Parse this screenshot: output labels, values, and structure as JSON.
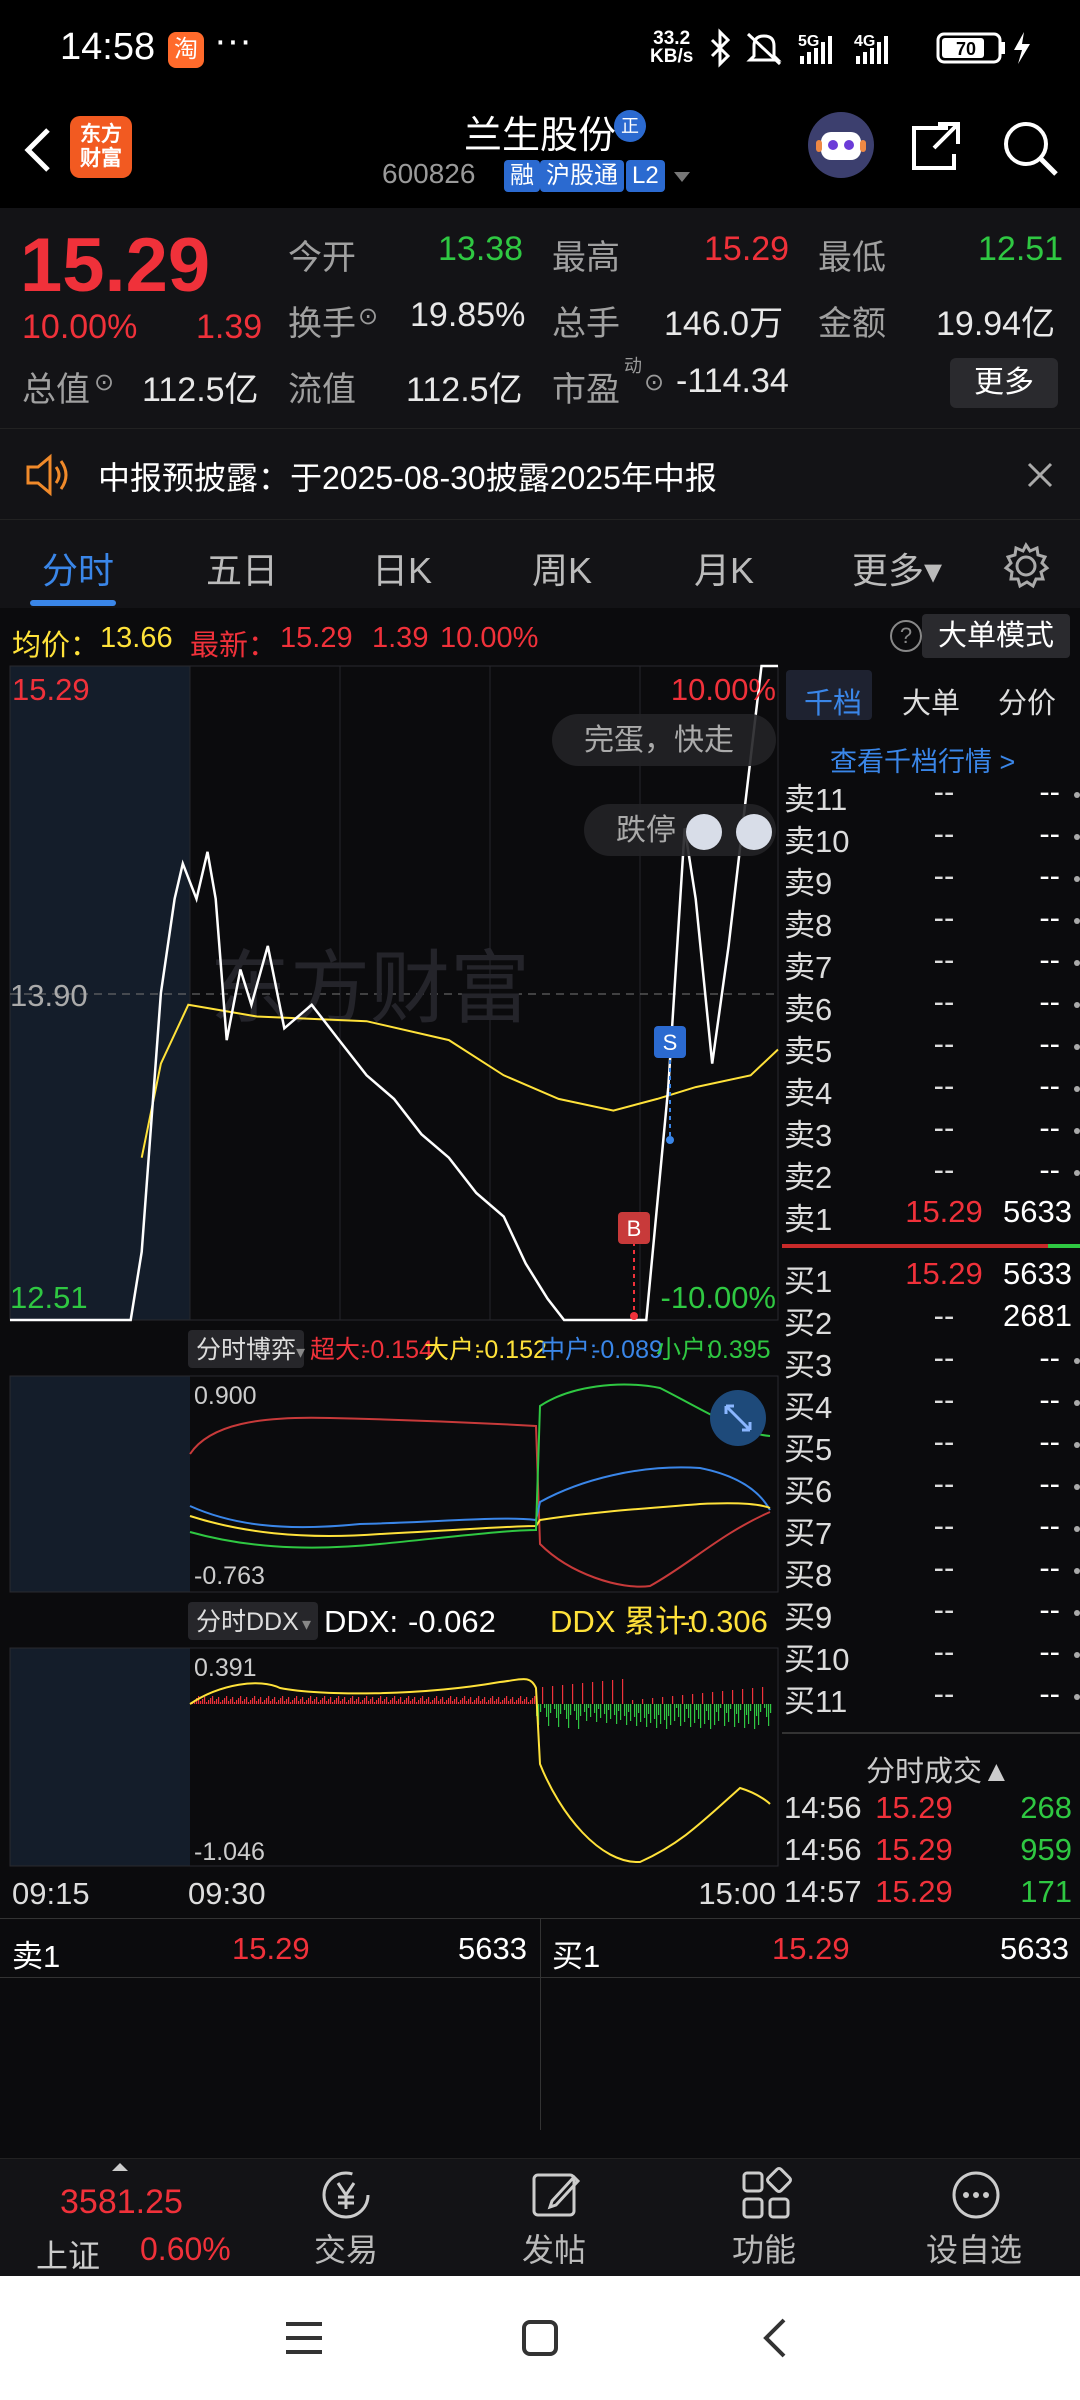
{
  "status_bar": {
    "time": "14:58",
    "dots": "···",
    "net_speed_value": "33.2",
    "net_speed_unit": "KB/s",
    "signals": "5G 4G",
    "battery": "70"
  },
  "header": {
    "title": "兰生股份",
    "badge_zheng": "正",
    "code": "600826",
    "tag_rong": "融",
    "tag_hgt": "沪股通",
    "tag_l2": "L2",
    "logo_line1": "东方",
    "logo_line2": "财富"
  },
  "quote": {
    "price": "15.29",
    "change_pct": "10.00%",
    "change": "1.39",
    "open_label": "今开",
    "open": "13.38",
    "high_label": "最高",
    "high": "15.29",
    "low_label": "最低",
    "low": "12.51",
    "turnover_label": "换手",
    "turnover": "19.85%",
    "volume_label": "总手",
    "volume": "146.0万",
    "amount_label": "金额",
    "amount": "19.94亿",
    "mktcap_label": "总值",
    "mktcap": "112.5亿",
    "float_label": "流值",
    "float_cap": "112.5亿",
    "pe_label": "市盈",
    "pe_sup": "动",
    "pe": "-114.34",
    "more_label": "更多"
  },
  "notice": {
    "text": "中报预披露：于2025-08-30披露2025年中报"
  },
  "tabs": [
    {
      "label": "分时"
    },
    {
      "label": "五日"
    },
    {
      "label": "日K"
    },
    {
      "label": "周K"
    },
    {
      "label": "月K"
    },
    {
      "label": "更多▾"
    }
  ],
  "infoline": {
    "avg_label": "均价：",
    "avg": "13.66",
    "last_label": "最新：",
    "last": "15.29",
    "chg": "1.39",
    "pct": "10.00%",
    "help": "?",
    "big_order_mode": "大单模式"
  },
  "chart": {
    "price_top": "15.29",
    "price_mid": "13.90",
    "price_bot": "12.51",
    "pct_top": "10.00%",
    "pct_bot": "-10.00%",
    "bubble1": "完蛋，快走",
    "bubble2": "跌停",
    "marker_s": "S",
    "marker_b": "B",
    "watermark": "东方财富",
    "bottom_tag": "分时博弈",
    "super_label": "超大:",
    "super_val": "-0.154",
    "big_label": "大户:",
    "big_val": "-0.152",
    "mid_label": "中户:",
    "mid_val": "-0.089",
    "small_label": "小户:",
    "small_val": "0.395",
    "ind1_top": "0.900",
    "ind1_bot": "-0.763",
    "ddx_tag": "分时DDX",
    "ddx_label": "DDX:",
    "ddx_val": "-0.062",
    "ddxsum_label": "DDX 累计:",
    "ddxsum_val": "-0.306",
    "ind2_top": "0.391",
    "ind2_bot": "-1.046",
    "time_start": "09:15",
    "time_open": "09:30",
    "time_end": "15:00"
  },
  "chart_data": {
    "type": "line",
    "title": "",
    "ylim": [
      12.51,
      15.29
    ],
    "price_series": [
      [
        0,
        12.51
      ],
      [
        44,
        12.51
      ],
      [
        48,
        12.8
      ],
      [
        55,
        13.9
      ],
      [
        60,
        14.3
      ],
      [
        63,
        14.45
      ],
      [
        68,
        14.3
      ],
      [
        72,
        14.5
      ],
      [
        75,
        14.3
      ],
      [
        79,
        13.7
      ],
      [
        84,
        14.0
      ],
      [
        88,
        13.85
      ],
      [
        94,
        14.1
      ],
      [
        100,
        13.75
      ],
      [
        110,
        13.85
      ],
      [
        120,
        13.7
      ],
      [
        130,
        13.55
      ],
      [
        140,
        13.45
      ],
      [
        150,
        13.3
      ],
      [
        160,
        13.2
      ],
      [
        170,
        13.05
      ],
      [
        180,
        12.95
      ],
      [
        188,
        12.75
      ],
      [
        196,
        12.6
      ],
      [
        202,
        12.51
      ],
      [
        232,
        12.51
      ],
      [
        240,
        13.5
      ],
      [
        246,
        14.6
      ],
      [
        250,
        14.3
      ],
      [
        256,
        13.6
      ],
      [
        262,
        14.1
      ],
      [
        268,
        14.7
      ],
      [
        274,
        15.29
      ],
      [
        280,
        15.29
      ]
    ],
    "avg_series": [
      [
        48,
        13.2
      ],
      [
        55,
        13.6
      ],
      [
        65,
        13.85
      ],
      [
        90,
        13.8
      ],
      [
        130,
        13.78
      ],
      [
        160,
        13.7
      ],
      [
        180,
        13.55
      ],
      [
        200,
        13.45
      ],
      [
        220,
        13.4
      ],
      [
        236,
        13.45
      ],
      [
        250,
        13.5
      ],
      [
        270,
        13.55
      ],
      [
        280,
        13.66
      ]
    ]
  },
  "orderbook": {
    "tabs": [
      {
        "label": "千档"
      },
      {
        "label": "大单"
      },
      {
        "label": "分价"
      }
    ],
    "link": "查看千档行情 >",
    "sells": [
      {
        "label": "卖11",
        "price": "--",
        "vol": "--"
      },
      {
        "label": "卖10",
        "price": "--",
        "vol": "--"
      },
      {
        "label": "卖9",
        "price": "--",
        "vol": "--"
      },
      {
        "label": "卖8",
        "price": "--",
        "vol": "--"
      },
      {
        "label": "卖7",
        "price": "--",
        "vol": "--"
      },
      {
        "label": "卖6",
        "price": "--",
        "vol": "--"
      },
      {
        "label": "卖5",
        "price": "--",
        "vol": "--"
      },
      {
        "label": "卖4",
        "price": "--",
        "vol": "--"
      },
      {
        "label": "卖3",
        "price": "--",
        "vol": "--"
      },
      {
        "label": "卖2",
        "price": "--",
        "vol": "--"
      },
      {
        "label": "卖1",
        "price": "15.29",
        "vol": "5633"
      }
    ],
    "buys": [
      {
        "label": "买1",
        "price": "15.29",
        "vol": "5633"
      },
      {
        "label": "买2",
        "price": "--",
        "vol": "2681"
      },
      {
        "label": "买3",
        "price": "--",
        "vol": "--"
      },
      {
        "label": "买4",
        "price": "--",
        "vol": "--"
      },
      {
        "label": "买5",
        "price": "--",
        "vol": "--"
      },
      {
        "label": "买6",
        "price": "--",
        "vol": "--"
      },
      {
        "label": "买7",
        "price": "--",
        "vol": "--"
      },
      {
        "label": "买8",
        "price": "--",
        "vol": "--"
      },
      {
        "label": "买9",
        "price": "--",
        "vol": "--"
      },
      {
        "label": "买10",
        "price": "--",
        "vol": "--"
      },
      {
        "label": "买11",
        "price": "--",
        "vol": "--"
      }
    ],
    "trades_title": "分时成交▲",
    "trades": [
      {
        "time": "14:56",
        "price": "15.29",
        "vol": "268"
      },
      {
        "time": "14:56",
        "price": "15.29",
        "vol": "959"
      },
      {
        "time": "14:57",
        "price": "15.29",
        "vol": "171"
      }
    ]
  },
  "order_bar": {
    "sell_label": "卖1",
    "sell_price": "15.29",
    "sell_vol": "5633",
    "buy_label": "买1",
    "buy_price": "15.29",
    "buy_vol": "5633"
  },
  "bottom_nav": {
    "index_value": "3581.25",
    "index_name": "上证",
    "index_pct": "0.60%",
    "items": [
      {
        "label": "交易"
      },
      {
        "label": "发帖"
      },
      {
        "label": "功能"
      },
      {
        "label": "设自选"
      }
    ]
  }
}
